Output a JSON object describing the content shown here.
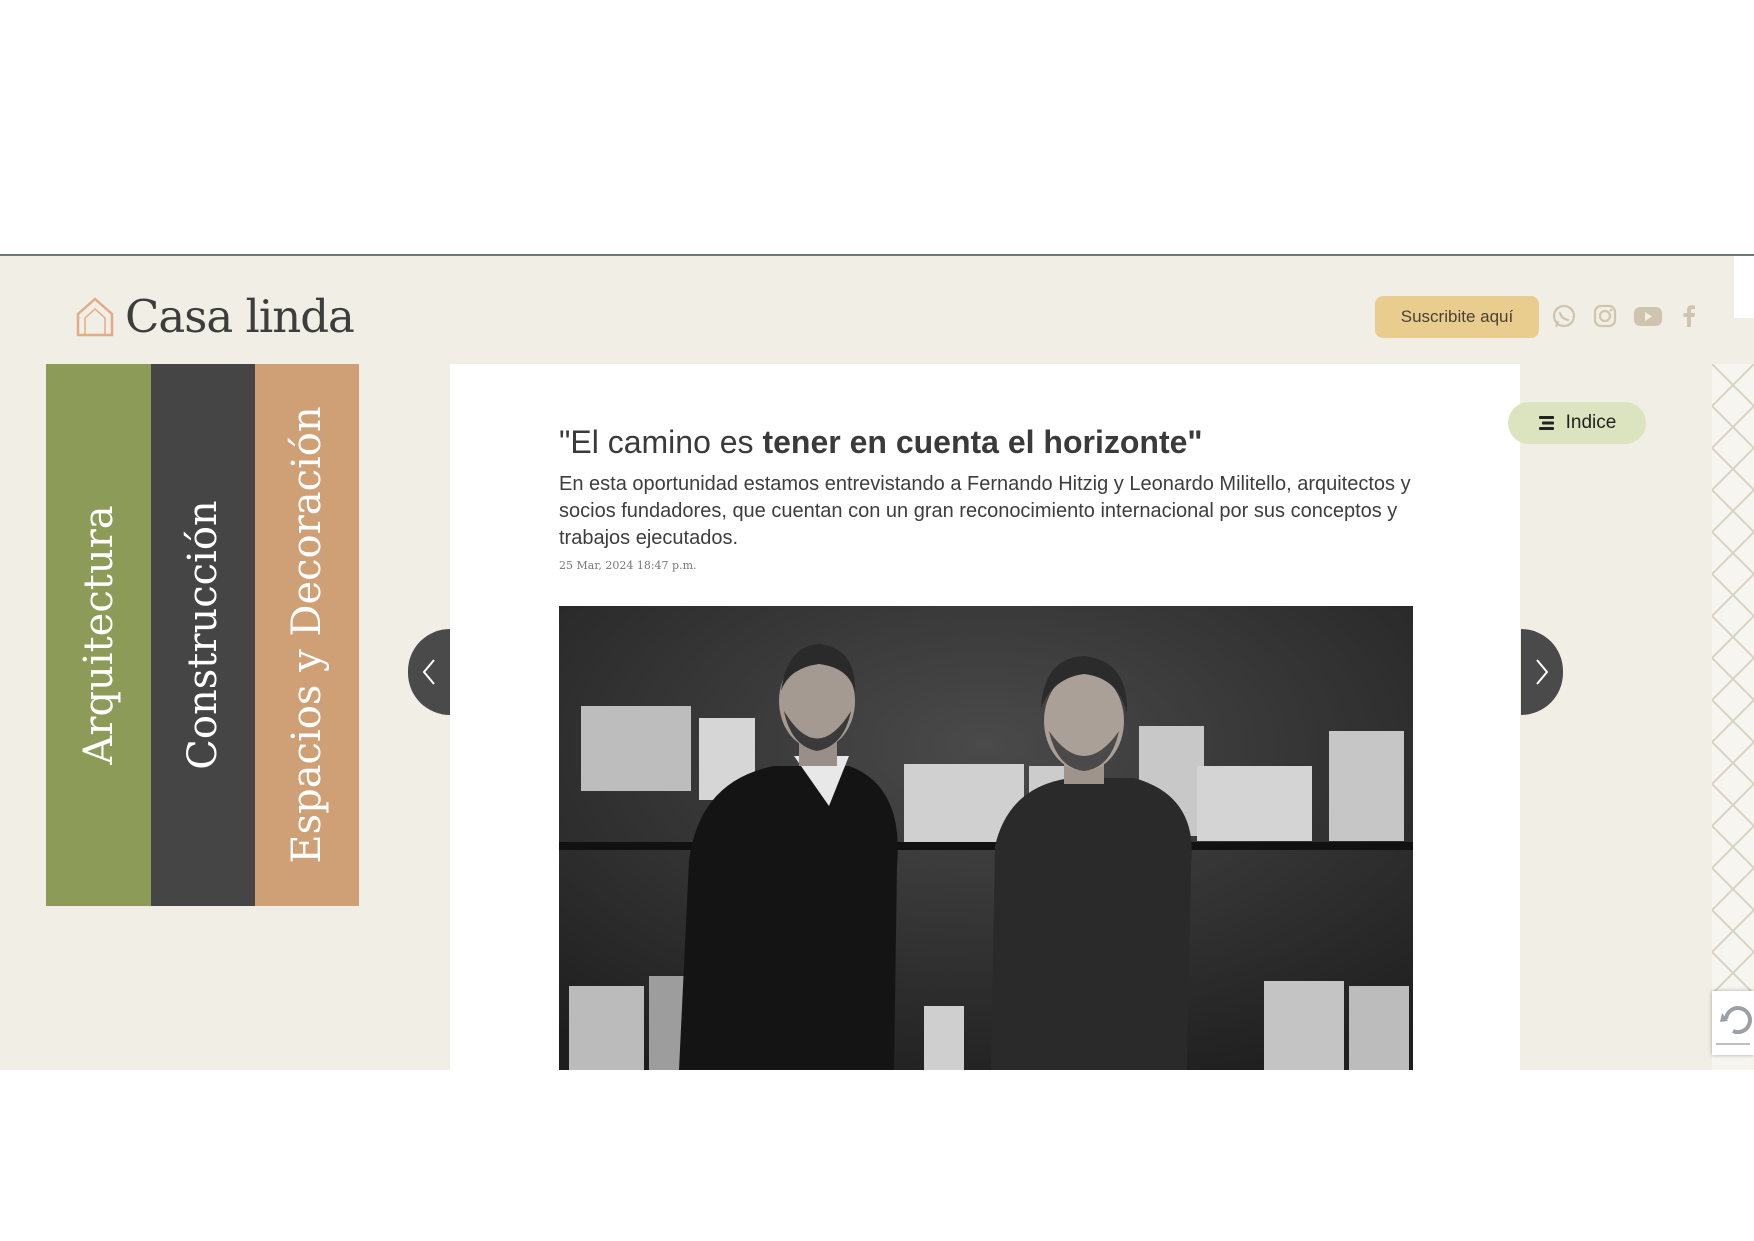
{
  "brand": {
    "name": "Casa linda"
  },
  "header": {
    "subscribe_label": "Suscribite aquí",
    "social": [
      "whatsapp-icon",
      "instagram-icon",
      "youtube-icon",
      "facebook-icon"
    ]
  },
  "categories": [
    {
      "label": "Arquitectura",
      "color": "#8c9b58"
    },
    {
      "label": "Construcción",
      "color": "#454545"
    },
    {
      "label": "Espacios y Decoración",
      "color": "#cf9f75"
    }
  ],
  "article": {
    "title_regular": "\"El camino es ",
    "title_bold": "tener en cuenta el horizonte\"",
    "summary": "En esta oportunidad estamos entrevistando a Fernando Hitzig y Leonardo Militello, arquitectos y socios fundadores, que cuentan con un gran reconocimiento internacional por sus conceptos y trabajos ejecutados.",
    "date": "25 Mar, 2024 18:47 p.m."
  },
  "indice": {
    "label": "Indice"
  },
  "colors": {
    "background": "#f1eee6",
    "accent_gold": "#e9cd8f",
    "indice_bg": "#dce3bf",
    "social_icon": "#cfc5ae"
  }
}
